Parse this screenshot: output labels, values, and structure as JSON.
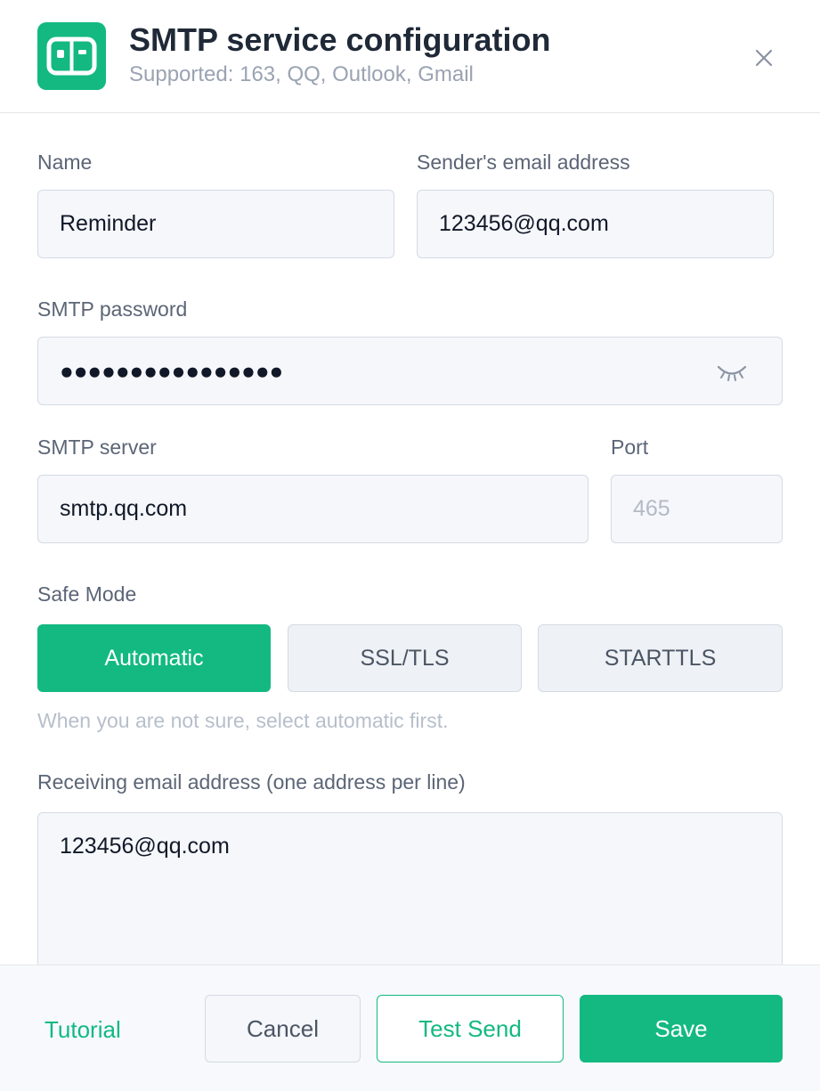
{
  "header": {
    "title": "SMTP service configuration",
    "subtitle": "Supported: 163, QQ, Outlook, Gmail",
    "app_icon": "mailbox-icon",
    "close_icon": "close-icon"
  },
  "form": {
    "name": {
      "label": "Name",
      "value": "Reminder"
    },
    "sender": {
      "label": "Sender's email address",
      "value": "123456@qq.com"
    },
    "password": {
      "label": "SMTP password",
      "masked_value": "●●●●●●●●●●●●●●●●",
      "toggle_icon": "eye-closed-icon"
    },
    "server": {
      "label": "SMTP server",
      "value": "smtp.qq.com"
    },
    "port": {
      "label": "Port",
      "placeholder": "465"
    },
    "safe_mode": {
      "label": "Safe Mode",
      "options": [
        "Automatic",
        "SSL/TLS",
        "STARTTLS"
      ],
      "selected": "Automatic",
      "hint": "When you are not sure, select automatic first."
    },
    "receivers": {
      "label": "Receiving email address (one address per line)",
      "value": "123456@qq.com"
    }
  },
  "footer": {
    "tutorial": "Tutorial",
    "cancel": "Cancel",
    "test_send": "Test Send",
    "save": "Save"
  },
  "colors": {
    "accent": "#13b980",
    "field_bg": "#f5f7fb",
    "border": "#d4dae4",
    "label": "#5b6576",
    "hint": "#b6bfcb"
  }
}
